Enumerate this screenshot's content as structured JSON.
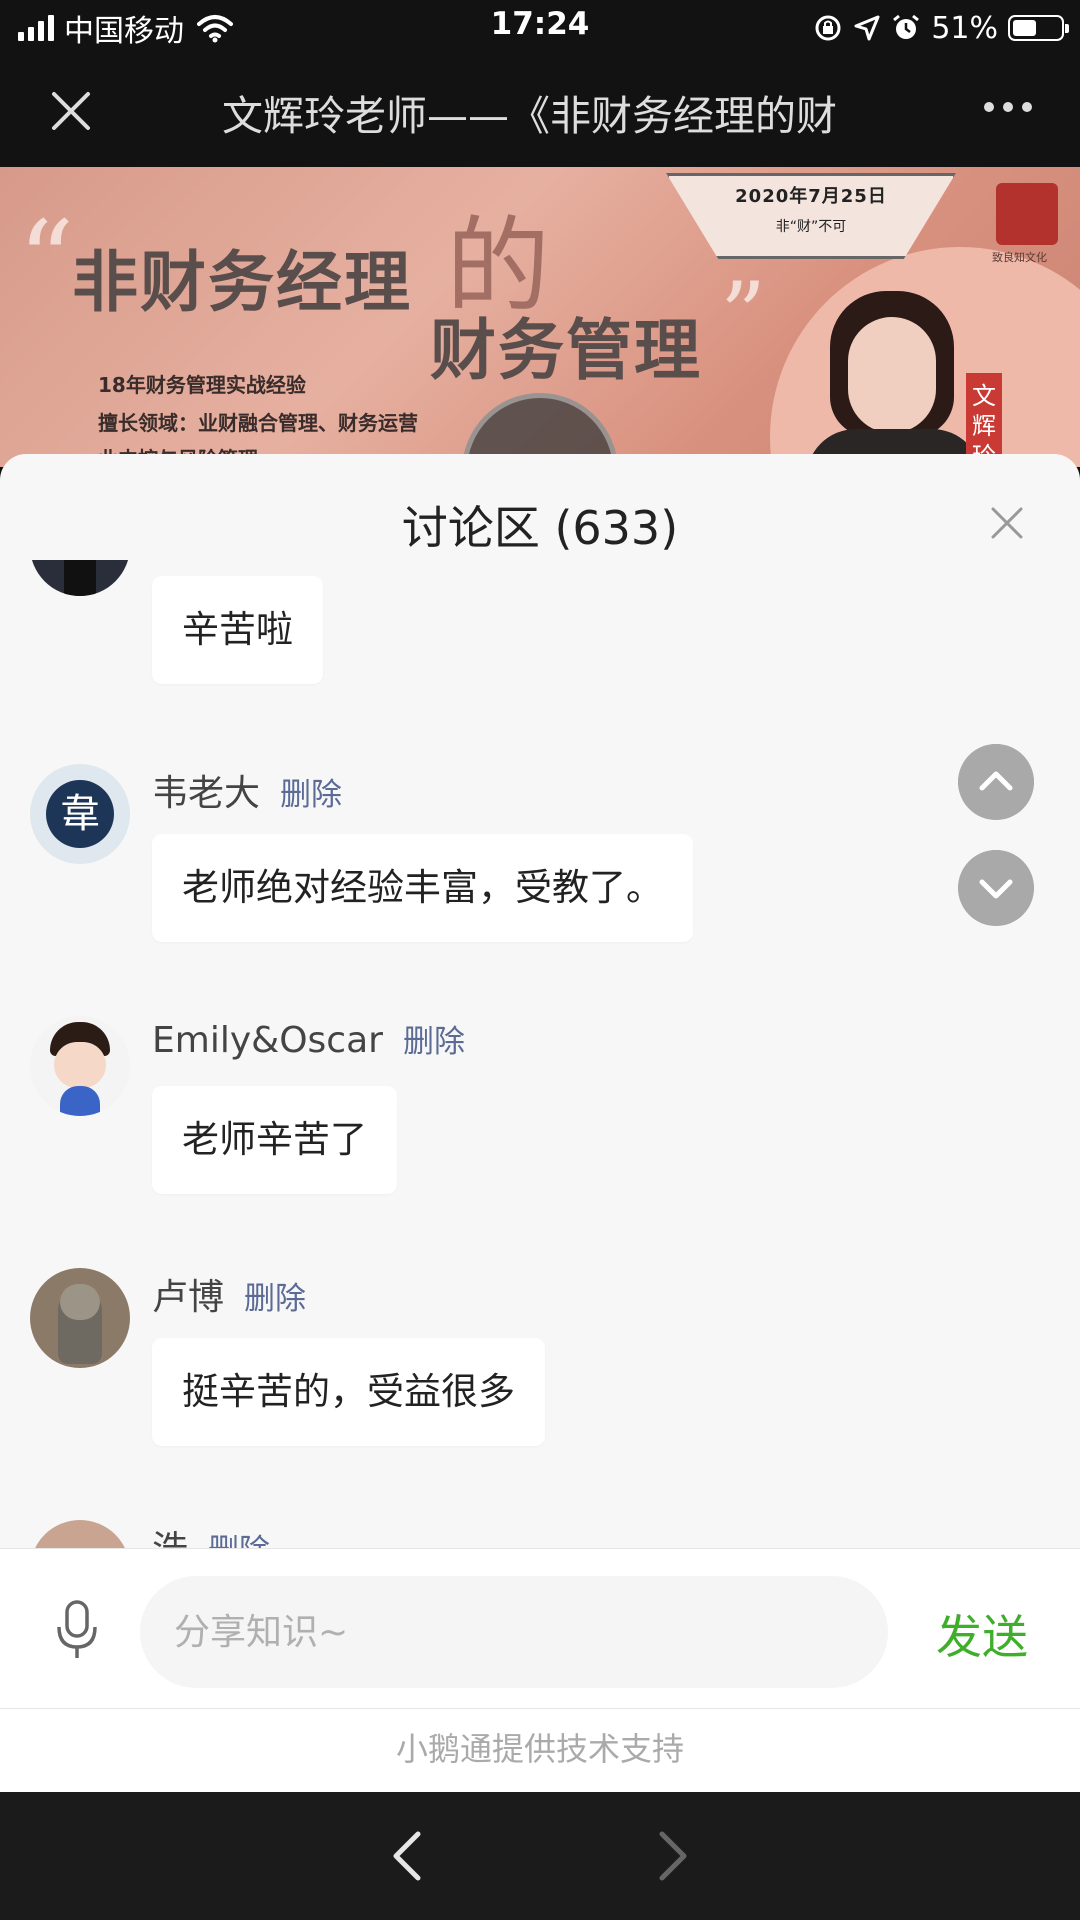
{
  "status_bar": {
    "carrier": "中国移动",
    "time": "17:24",
    "battery": "51%",
    "battery_level": 0.51
  },
  "titlebar": {
    "title": "文辉玲老师——《非财务经理的财"
  },
  "banner": {
    "headline_1": "非财务经理",
    "headline_de": "的",
    "headline_2": "财务管理",
    "quote_open": "“",
    "quote_close": "”",
    "date": "2020年7月25日",
    "date_sub": "非“财”不可",
    "seal_caption": "致良知文化",
    "experience": "18年财务管理实战经验",
    "field": "擅长领域：业财融合管理、财务运营",
    "field_cut": "业内控与风险管理",
    "name_tag": "文辉玲"
  },
  "sheet": {
    "title": "讨论区 (633)"
  },
  "comments": [
    {
      "username": "",
      "delete": "",
      "text": "辛苦啦",
      "avatar": "person-dark-avatar"
    },
    {
      "username": "韦老大",
      "delete": "删除",
      "text": "老师绝对经验丰富，受教了。",
      "avatar": "wei-seal-avatar",
      "avatar_char": "韋"
    },
    {
      "username": "Emily&Oscar",
      "delete": "删除",
      "text": "老师辛苦了",
      "avatar": "cartoon-boy-avatar"
    },
    {
      "username": "卢博",
      "delete": "删除",
      "text": "挺辛苦的，受益很多",
      "avatar": "cat-avatar"
    },
    {
      "username": "浩",
      "delete": "删除",
      "text": "",
      "avatar": "woman-avatar"
    }
  ],
  "input": {
    "placeholder": "分享知识~",
    "send_label": "发送"
  },
  "footer": {
    "powered_by": "小鹅通提供技术支持"
  },
  "colors": {
    "accent_green": "#3fae2a",
    "delete_link": "#5b6b95",
    "sheet_bg": "#f7f7f7"
  },
  "icons": [
    "signal-icon",
    "wifi-icon",
    "rotation-lock-icon",
    "location-icon",
    "alarm-icon",
    "battery-icon",
    "close-icon",
    "more-icon",
    "play-icon",
    "chevron-up-icon",
    "chevron-down-icon",
    "microphone-icon",
    "back-arrow-icon",
    "forward-arrow-icon"
  ]
}
